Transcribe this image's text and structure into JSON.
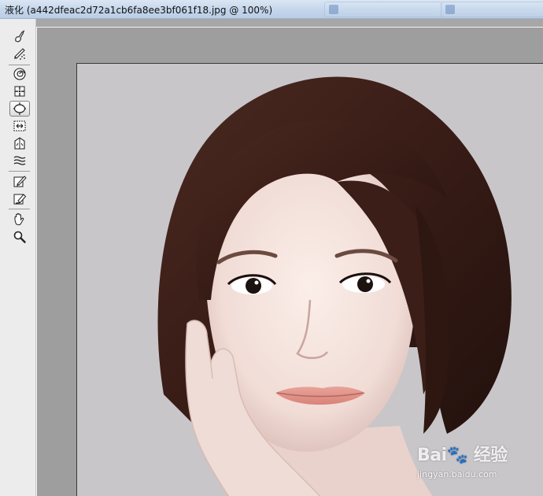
{
  "window": {
    "title": "液化 (a442dfeac2d72a1cb6fa8ee3bf061f18.jpg @ 100%)"
  },
  "toolbox": {
    "tools": [
      {
        "name": "forward-warp-tool",
        "icon": "finger-brush-icon"
      },
      {
        "name": "reconstruct-tool",
        "icon": "brush-dots-icon"
      },
      {
        "name": "twirl-clockwise-tool",
        "icon": "twirl-icon"
      },
      {
        "name": "pucker-tool",
        "icon": "pucker-icon"
      },
      {
        "name": "bloat-tool",
        "icon": "bloat-icon",
        "selected": true
      },
      {
        "name": "push-left-tool",
        "icon": "push-left-icon"
      },
      {
        "name": "mirror-tool",
        "icon": "mirror-icon"
      },
      {
        "name": "turbulence-tool",
        "icon": "turbulence-icon"
      },
      {
        "name": "freeze-mask-tool",
        "icon": "freeze-mask-icon"
      },
      {
        "name": "thaw-mask-tool",
        "icon": "thaw-mask-icon"
      },
      {
        "name": "hand-tool",
        "icon": "hand-icon"
      },
      {
        "name": "zoom-tool",
        "icon": "magnifier-icon"
      }
    ]
  },
  "watermark": {
    "logo_text": "Bai🐾 经验",
    "url_text": "jingyan.baidu.com"
  },
  "colors": {
    "canvas_bg": "#a7a7a7",
    "toolbox_bg": "#ececec",
    "titlebar": "#c6d7ec"
  }
}
